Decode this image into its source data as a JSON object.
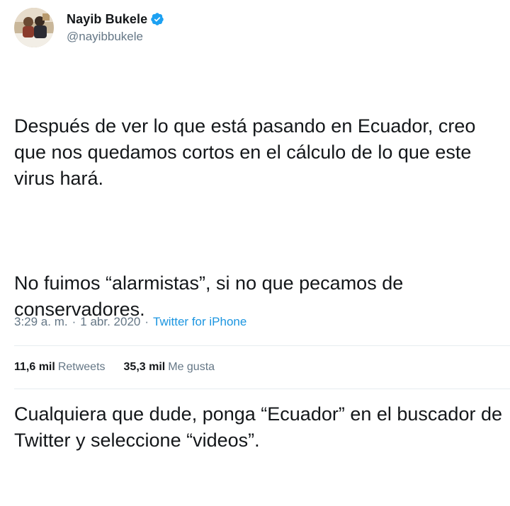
{
  "author": {
    "display_name": "Nayib Bukele",
    "handle": "@nayibbukele",
    "verified_icon": "verified-badge-icon",
    "avatar": "profile-photo"
  },
  "tweet": {
    "paragraphs": [
      "Después de ver lo que está pasando en Ecuador, creo que nos quedamos cortos en el cálculo de lo que este virus hará.",
      "No fuimos “alarmistas”, si no que pecamos de conservadores.",
      "Cualquiera que dude, ponga “Ecuador” en el buscador de Twitter y seleccione “videos”."
    ]
  },
  "meta": {
    "time": "3:29 a. m.",
    "separator1": "·",
    "date": "1 abr. 2020",
    "separator2": "·",
    "source": "Twitter for iPhone"
  },
  "stats": {
    "retweets_count": "11,6 mil",
    "retweets_label": "Retweets",
    "likes_count": "35,3 mil",
    "likes_label": "Me gusta"
  },
  "colors": {
    "link": "#1b95e0",
    "secondary_text": "#657786",
    "primary_text": "#14171a",
    "verified": "#1da1f2"
  }
}
